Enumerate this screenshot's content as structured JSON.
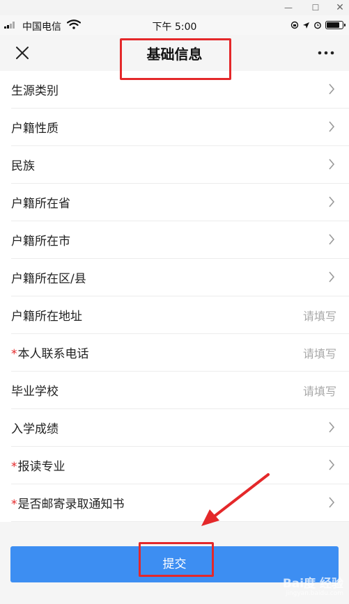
{
  "status_bar": {
    "carrier": "中国电信",
    "time": "下午 5:00",
    "battery_level": 0.85
  },
  "nav": {
    "title": "基础信息"
  },
  "form": {
    "rows": [
      {
        "label": "生源类别",
        "required": false,
        "type": "select"
      },
      {
        "label": "户籍性质",
        "required": false,
        "type": "select"
      },
      {
        "label": "民族",
        "required": false,
        "type": "select"
      },
      {
        "label": "户籍所在省",
        "required": false,
        "type": "select"
      },
      {
        "label": "户籍所在市",
        "required": false,
        "type": "select"
      },
      {
        "label": "户籍所在区/县",
        "required": false,
        "type": "select"
      },
      {
        "label": "户籍所在地址",
        "required": false,
        "type": "input",
        "placeholder": "请填写"
      },
      {
        "label": "本人联系电话",
        "required": true,
        "type": "input",
        "placeholder": "请填写"
      },
      {
        "label": "毕业学校",
        "required": false,
        "type": "input",
        "placeholder": "请填写"
      },
      {
        "label": "入学成绩",
        "required": false,
        "type": "select"
      },
      {
        "label": "报读专业",
        "required": true,
        "type": "select"
      },
      {
        "label": "是否邮寄录取通知书",
        "required": true,
        "type": "select"
      }
    ],
    "required_mark": "*"
  },
  "footer": {
    "submit_label": "提交"
  },
  "watermark": {
    "text": "Bai度 经验",
    "sub": "jingyan.baidu.com"
  },
  "colors": {
    "primary": "#3d8ef2",
    "annotation": "#e4282a",
    "placeholder": "#a8a8a8"
  }
}
